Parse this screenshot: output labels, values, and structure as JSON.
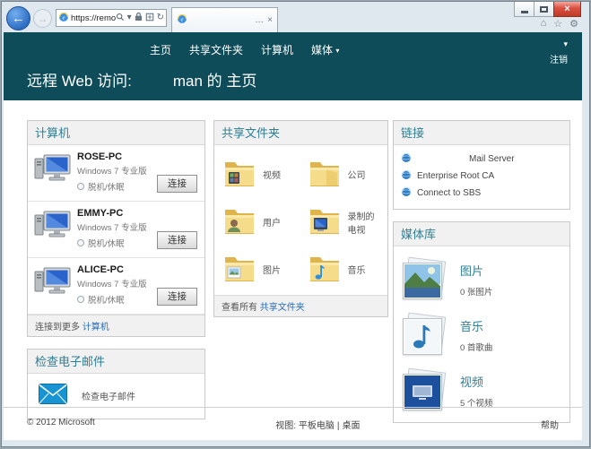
{
  "colors": {
    "header_teal": "#0e4c59",
    "section_title": "#2e7f93",
    "link_blue": "#2b6cb5"
  },
  "icons": {
    "back": "←",
    "forward": "→",
    "refresh": "↻",
    "dropdown": "▾",
    "home": "⌂",
    "favorites": "☆",
    "tools": "⚙",
    "tab_ellipsis": "…",
    "tab_close": "×",
    "window_close": "×"
  },
  "browser": {
    "url": "https://remote."
  },
  "site_header": {
    "nav": [
      {
        "label": "主页"
      },
      {
        "label": "共享文件夹"
      },
      {
        "label": "计算机"
      },
      {
        "label": "媒体"
      }
    ],
    "signout": "注销",
    "title_prefix": "远程 Web 访问:",
    "title_user": "man 的 主页"
  },
  "computers": {
    "title": "计算机",
    "items": [
      {
        "name": "ROSE-PC",
        "os": "Windows 7 专业版",
        "status": "脱机/休眠",
        "connect": "连接"
      },
      {
        "name": "EMMY-PC",
        "os": "Windows 7 专业版",
        "status": "脱机/休眠",
        "connect": "连接"
      },
      {
        "name": "ALICE-PC",
        "os": "Windows 7 专业版",
        "status": "脱机/休眠",
        "connect": "连接"
      }
    ],
    "footer_text": "连接到更多",
    "footer_link": "计算机"
  },
  "email": {
    "title": "检查电子邮件",
    "link": "检查电子邮件"
  },
  "shared_folders": {
    "title": "共享文件夹",
    "items": [
      {
        "label": "视频"
      },
      {
        "label": "公司"
      },
      {
        "label": "用户"
      },
      {
        "label": "录制的电视"
      },
      {
        "label": "图片"
      },
      {
        "label": "音乐"
      }
    ],
    "footer_text": "查看所有",
    "footer_link": "共享文件夹"
  },
  "links": {
    "title": "链接",
    "items": [
      {
        "label": "Mail Server"
      },
      {
        "label": "Enterprise Root CA"
      },
      {
        "label": "Connect to SBS"
      }
    ]
  },
  "media_library": {
    "title": "媒体库",
    "items": [
      {
        "label": "图片",
        "count": "0 张图片"
      },
      {
        "label": "音乐",
        "count": "0 首歌曲"
      },
      {
        "label": "视频",
        "count": "5 个视频"
      }
    ]
  },
  "page_footer": {
    "copyright": "© 2012 Microsoft",
    "view_label": "视图:",
    "view_tablet": "平板电脑",
    "view_separator": "|",
    "view_desktop": "桌面",
    "help": "帮助"
  }
}
